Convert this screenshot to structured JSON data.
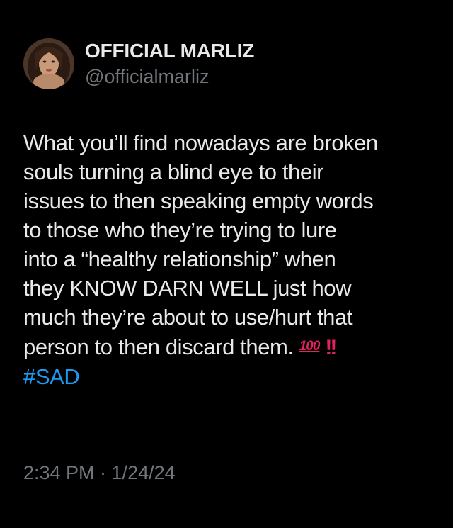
{
  "author": {
    "display_name": "OFFICIAL MARLIZ",
    "handle": "@officialmarliz",
    "avatar_icon": "profile-photo"
  },
  "tweet": {
    "lines": [
      "What you’ll find nowadays are broken",
      "souls turning a blind eye to their",
      "issues to then speaking empty words",
      "to those who they’re trying to lure",
      "into a “healthy relationship” when",
      "they KNOW DARN WELL just how",
      "much they’re about to use/hurt that",
      "person to then discard them."
    ],
    "emojis": {
      "hundred": "100",
      "double_exclamation": "!!"
    },
    "hashtag": "#SAD"
  },
  "meta": {
    "timestamp": "2:34 PM · 1/24/24"
  },
  "colors": {
    "background": "#000000",
    "text": "#e7e9ea",
    "secondary_text": "#71767b",
    "link": "#1d9bf0",
    "emoji_red": "#e0245e"
  }
}
